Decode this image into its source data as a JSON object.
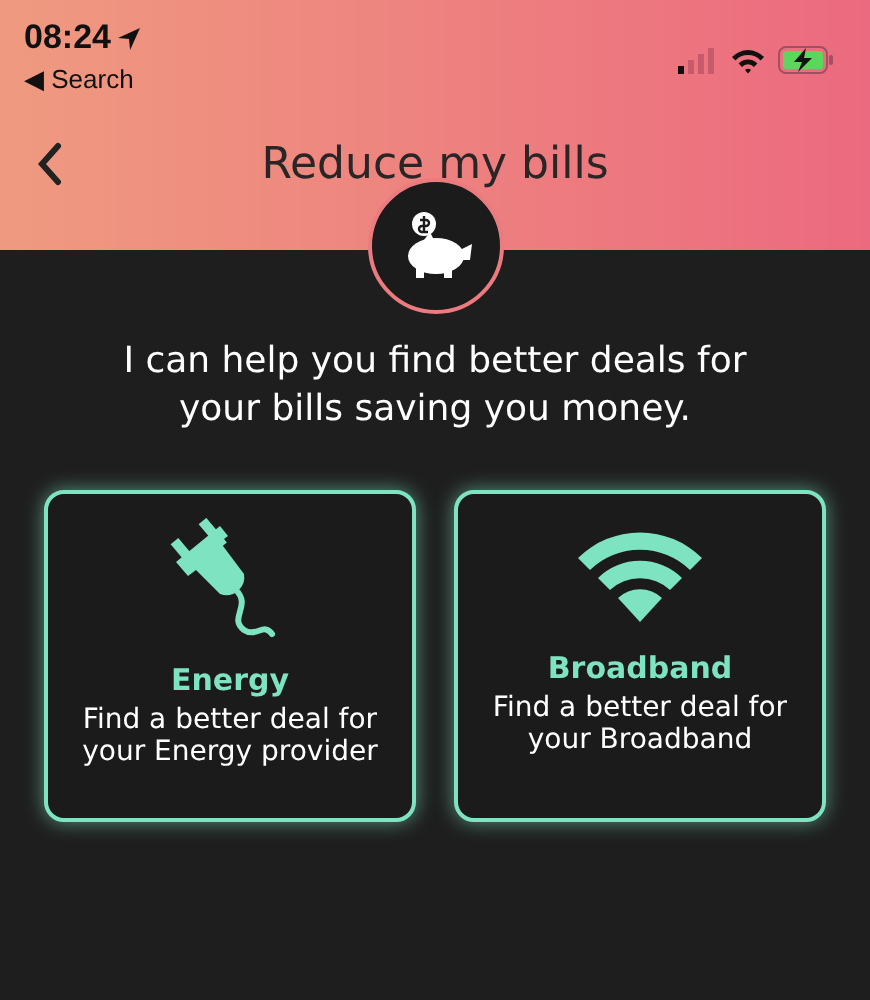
{
  "status_bar": {
    "time": "08:24",
    "back_label": "◀ Search"
  },
  "header": {
    "title": "Reduce my bills"
  },
  "intro": "I can help you find better deals for your bills saving you money.",
  "cards": [
    {
      "kind": "energy",
      "title": "Energy",
      "text": "Find a better deal for your Energy provider"
    },
    {
      "kind": "broadband",
      "title": "Broadband",
      "text": "Find a better deal for your Broadband"
    }
  ]
}
